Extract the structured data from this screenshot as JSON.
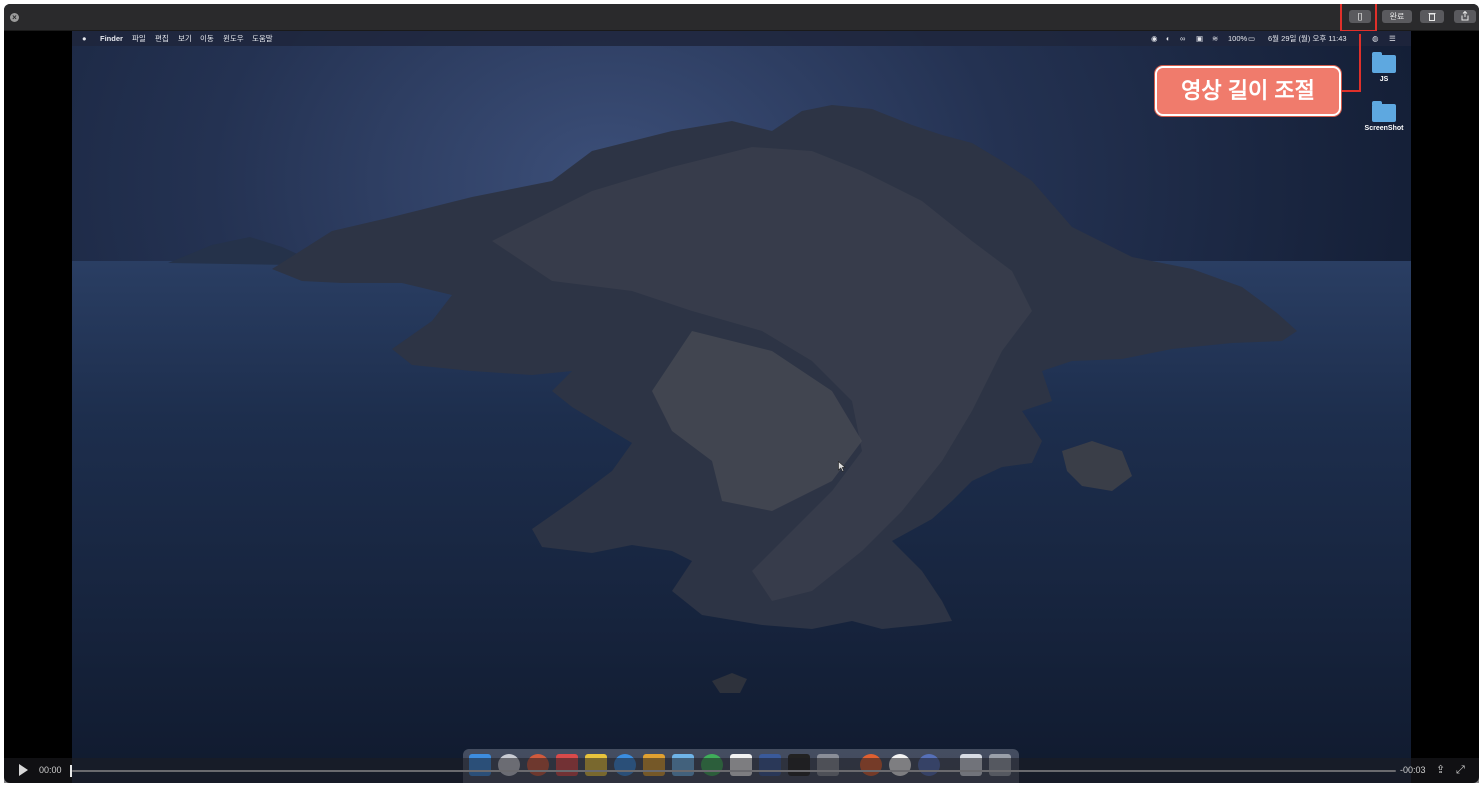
{
  "toolbar": {
    "trim_icon": "[]",
    "done_label": "완료",
    "trash_icon": "trash-icon",
    "share_icon": "share-icon"
  },
  "menubar": {
    "apple": "",
    "app": "Finder",
    "items": [
      "파일",
      "편집",
      "보기",
      "이동",
      "윈도우",
      "도움말"
    ],
    "battery": "100%",
    "datetime": "6월 29일 (월) 오후 11:43"
  },
  "desktop": {
    "icons": [
      {
        "label": "JS"
      },
      {
        "label": "ScreenShot"
      }
    ]
  },
  "callout": {
    "text": "영상 길이 조절",
    "color": "#f07b6c",
    "highlight_color": "#e0302a"
  },
  "player": {
    "current_time": "00:00",
    "remaining_time": "-00:03",
    "progress": 0
  }
}
